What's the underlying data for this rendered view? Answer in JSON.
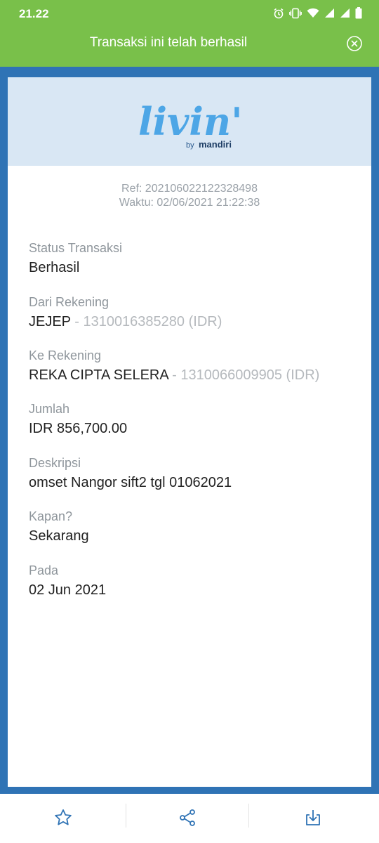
{
  "status_bar": {
    "time": "21.22"
  },
  "header": {
    "title": "Transaksi ini telah berhasil"
  },
  "logo": {
    "brand": "livin'",
    "by": "by",
    "company": "mandiri"
  },
  "receipt": {
    "ref": "Ref: 20210602212232849​8",
    "waktu": "Waktu: 02/06/2021 21:22:38",
    "fields": [
      {
        "label": "Status Transaksi",
        "value": "Berhasil",
        "sub": ""
      },
      {
        "label": "Dari Rekening",
        "value": "JEJEP",
        "sub": " - 1310016385280 (IDR)"
      },
      {
        "label": "Ke Rekening",
        "value": "REKA CIPTA SELERA",
        "sub": " - 1310066009905 (IDR)"
      },
      {
        "label": "Jumlah",
        "value": "IDR 856,700.00",
        "sub": ""
      },
      {
        "label": "Deskripsi",
        "value": "omset Nangor sift2 tgl 01062021",
        "sub": ""
      },
      {
        "label": "Kapan?",
        "value": "Sekarang",
        "sub": ""
      },
      {
        "label": "Pada",
        "value": "02 Jun 2021",
        "sub": ""
      }
    ]
  },
  "colors": {
    "header": "#79c04a",
    "frame": "#2f73b5",
    "logo_band": "#d9e7f4",
    "accent_blue": "#2f73b5"
  },
  "icons": [
    "alarm-icon",
    "vibrate-icon",
    "wifi-icon",
    "signal-icon",
    "battery-icon",
    "close-circle-icon",
    "star-icon",
    "share-icon",
    "download-icon"
  ]
}
